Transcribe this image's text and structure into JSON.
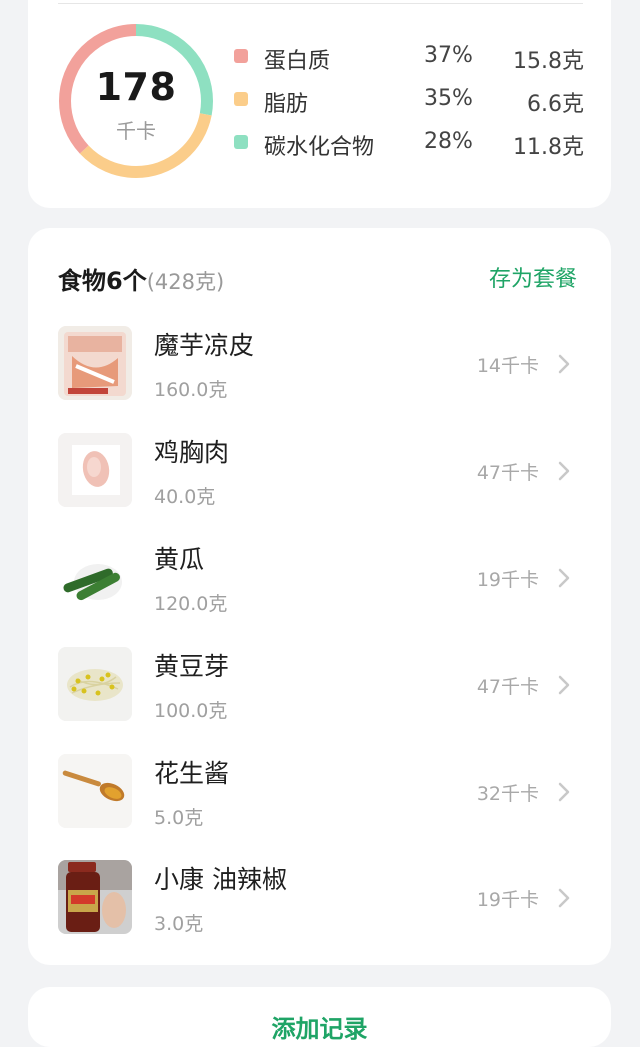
{
  "summary": {
    "calories": "178",
    "calorie_unit": "千卡",
    "macros": [
      {
        "name": "蛋白质",
        "percent": "37%",
        "amount": "15.8克",
        "color": "#f2a19b"
      },
      {
        "name": "脂肪",
        "percent": "35%",
        "amount": "6.6克",
        "color": "#fbcd8a"
      },
      {
        "name": "碳水化合物",
        "percent": "28%",
        "amount": "11.8克",
        "color": "#8ee0c1"
      }
    ]
  },
  "foods": {
    "title": "食物6个",
    "total_weight": "(428克)",
    "save_label": "存为套餐",
    "items": [
      {
        "name": "魔芋凉皮",
        "amount": "160.0克",
        "kcal": "14千卡",
        "icon": "konjac-package"
      },
      {
        "name": "鸡胸肉",
        "amount": "40.0克",
        "kcal": "47千卡",
        "icon": "chicken-breast"
      },
      {
        "name": "黄瓜",
        "amount": "120.0克",
        "kcal": "19千卡",
        "icon": "cucumber"
      },
      {
        "name": "黄豆芽",
        "amount": "100.0克",
        "kcal": "47千卡",
        "icon": "soybean-sprouts"
      },
      {
        "name": "花生酱",
        "amount": "5.0克",
        "kcal": "32千卡",
        "icon": "peanut-butter-spoon"
      },
      {
        "name": "小康 油辣椒",
        "amount": "3.0克",
        "kcal": "19千卡",
        "icon": "chili-oil-jar"
      }
    ]
  },
  "bottom": {
    "add_label": "添加记录"
  },
  "colors": {
    "accent": "#1fa466",
    "protein": "#f2a19b",
    "fat": "#fbcd8a",
    "carb": "#8ee0c1"
  }
}
